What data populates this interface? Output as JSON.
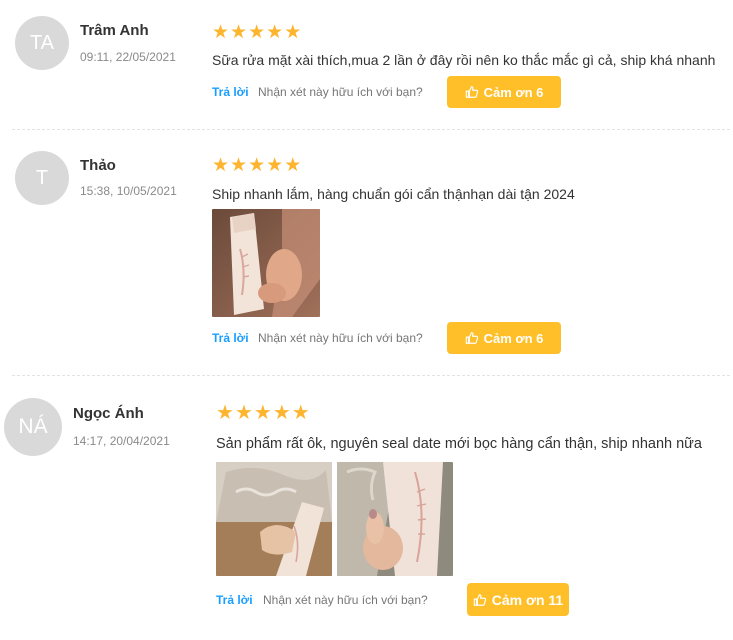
{
  "reviews": [
    {
      "initials": "TA",
      "name": "Trâm Anh",
      "datetime": "09:11, 22/05/2021",
      "rating": 5,
      "content": "Sữa rửa mặt xài thích,mua 2 lần ở đây rồi nên ko thắc mắc gì cả, ship khá nhanh",
      "reply_label": "Trả lời",
      "helpful_text": "Nhận xét này hữu ích với bạn?",
      "thanks_label": "Cảm ơn 6"
    },
    {
      "initials": "T",
      "name": "Thảo",
      "datetime": "15:38, 10/05/2021",
      "rating": 5,
      "content": "Ship nhanh lắm,  hàng chuẩn gói cẩn thậnhạn dài tận 2024",
      "reply_label": "Trả lời",
      "helpful_text": "Nhận xét này hữu ích với bạn?",
      "thanks_label": "Cảm ơn 6"
    },
    {
      "initials": "NÁ",
      "name": "Ngọc Ánh",
      "datetime": "14:17, 20/04/2021",
      "rating": 5,
      "content": "Sản phẩm rất ôk, nguyên seal date mới bọc hàng cẩn thận, ship nhanh nữa",
      "reply_label": "Trả lời",
      "helpful_text": "Nhận xét này hữu ích với bạn?",
      "thanks_label": "Cảm ơn 11"
    }
  ],
  "colors": {
    "star": "#fdb52f",
    "accent_link": "#189eff",
    "thanks_button": "#ffbf28",
    "avatar_bg": "#d9d9d9"
  },
  "icons": {
    "star": "star-icon",
    "thanks": "thumbs-up-icon"
  }
}
